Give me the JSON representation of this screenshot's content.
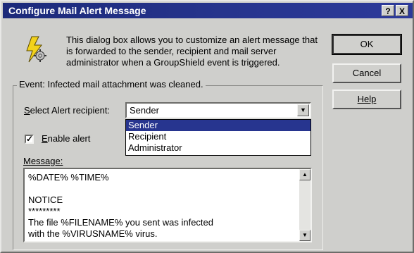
{
  "window": {
    "title": "Configure Mail Alert Message",
    "help_btn": "?",
    "close_btn": "X"
  },
  "description": "This dialog box allows you to customize an alert message that is forwarded to the sender, recipient and mail server administrator when a GroupShield event is triggered.",
  "buttons": {
    "ok": "OK",
    "cancel": "Cancel",
    "help": "Help"
  },
  "event_group": {
    "label": "Event: Infected mail attachment was cleaned."
  },
  "recipient": {
    "label_prefix": "S",
    "label_rest": "elect Alert recipient:",
    "value": "Sender",
    "options": [
      "Sender",
      "Recipient",
      "Administrator"
    ]
  },
  "enable_alert": {
    "label_prefix": "E",
    "label_rest": "nable alert",
    "checked": true
  },
  "message": {
    "label": "Message:",
    "text": "%DATE%  %TIME%\n\nNOTICE\n*********\nThe file  %FILENAME%  you sent was infected\nwith the  %VIRUSNAME%  virus."
  },
  "icons": {
    "info": "lightning-gear-icon",
    "dropdown_arrow": "chevron-down-icon",
    "scroll_up": "scroll-up-icon",
    "scroll_down": "scroll-down-icon"
  },
  "colors": {
    "titlebar": "#27358f",
    "selection": "#27358f",
    "face": "#cfcfcc"
  }
}
